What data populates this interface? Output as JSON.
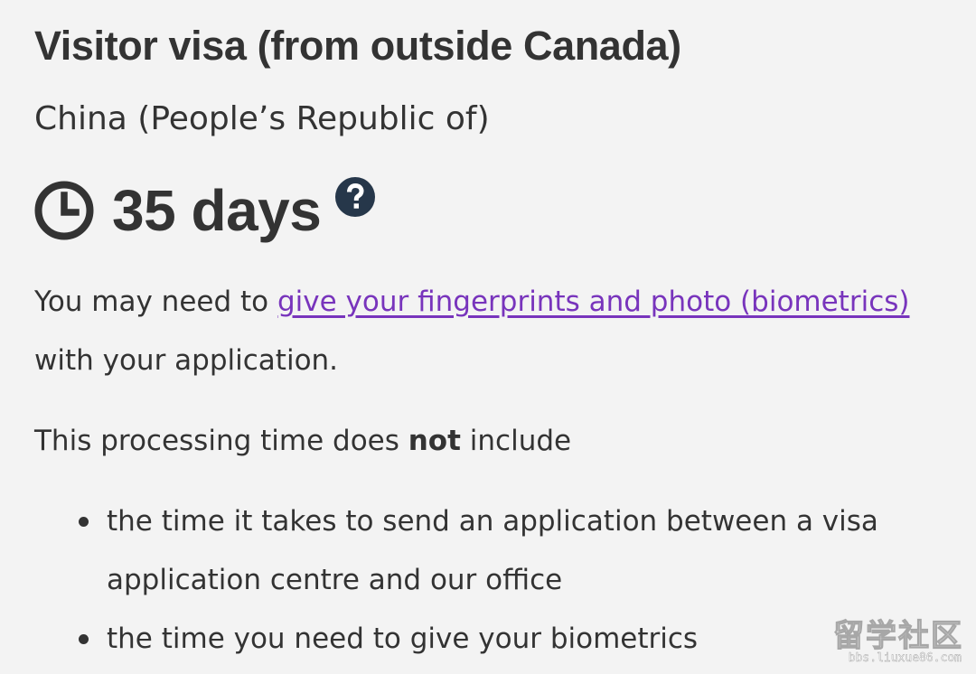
{
  "title": "Visitor visa (from outside Canada)",
  "country": "China (People’s Republic of)",
  "processing_time": "35 days",
  "icons": {
    "clock": "clock-icon",
    "help": "question-circle-icon"
  },
  "biometrics_paragraph": {
    "prefix": "You may need to ",
    "link_text": "give your fingerprints and photo (biometrics)",
    "suffix": " with your application."
  },
  "processing_note": {
    "prefix": "This processing time does ",
    "emphasis": "not",
    "suffix": " include"
  },
  "exclusions": [
    "the time it takes to send an application between a visa application centre and our office",
    "the time you need to give your biometrics"
  ],
  "watermark": {
    "text": "留学社区",
    "url": "bbs.liuxue86.com"
  },
  "colors": {
    "background": "#f3f3f3",
    "text": "#333333",
    "link": "#7834bc",
    "help_icon": "#26374a"
  }
}
